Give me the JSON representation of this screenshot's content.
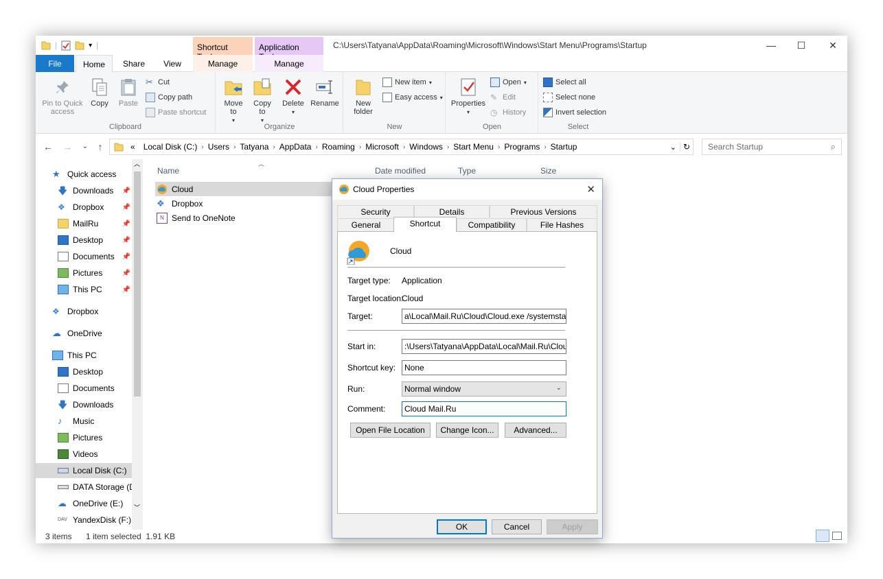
{
  "window": {
    "title_path": "C:\\Users\\Tatyana\\AppData\\Roaming\\Microsoft\\Windows\\Start Menu\\Programs\\Startup",
    "context_tabs": {
      "shortcut_tools": "Shortcut Tools",
      "application_tools": "Application Tools"
    }
  },
  "ribbon_tabs": {
    "file": "File",
    "home": "Home",
    "share": "Share",
    "view": "View",
    "manage1": "Manage",
    "manage2": "Manage"
  },
  "ribbon": {
    "clipboard": {
      "label": "Clipboard",
      "pin": "Pin to Quick access",
      "copy": "Copy",
      "paste": "Paste",
      "cut": "Cut",
      "copy_path": "Copy path",
      "paste_shortcut": "Paste shortcut"
    },
    "organize": {
      "label": "Organize",
      "move_to": "Move to",
      "copy_to": "Copy to",
      "delete": "Delete",
      "rename": "Rename"
    },
    "new": {
      "label": "New",
      "new_folder": "New folder",
      "new_item": "New item",
      "easy_access": "Easy access"
    },
    "open": {
      "label": "Open",
      "properties": "Properties",
      "open": "Open",
      "edit": "Edit",
      "history": "History"
    },
    "select": {
      "label": "Select",
      "select_all": "Select all",
      "select_none": "Select none",
      "invert": "Invert selection"
    }
  },
  "address": {
    "segments": [
      "«",
      "Local Disk (C:)",
      "Users",
      "Tatyana",
      "AppData",
      "Roaming",
      "Microsoft",
      "Windows",
      "Start Menu",
      "Programs",
      "Startup"
    ],
    "search_placeholder": "Search Startup"
  },
  "nav": {
    "items": [
      {
        "label": "Quick access"
      },
      {
        "label": "Downloads"
      },
      {
        "label": "Dropbox"
      },
      {
        "label": "MailRu"
      },
      {
        "label": "Desktop"
      },
      {
        "label": "Documents"
      },
      {
        "label": "Pictures"
      },
      {
        "label": "This PC"
      },
      {
        "label": "Dropbox"
      },
      {
        "label": "OneDrive"
      },
      {
        "label": "This PC"
      },
      {
        "label": "Desktop"
      },
      {
        "label": "Documents"
      },
      {
        "label": "Downloads"
      },
      {
        "label": "Music"
      },
      {
        "label": "Pictures"
      },
      {
        "label": "Videos"
      },
      {
        "label": "Local Disk (C:)"
      },
      {
        "label": "DATA Storage (D"
      },
      {
        "label": "OneDrive (E:)"
      },
      {
        "label": "YandexDisk (F:)"
      }
    ]
  },
  "files": {
    "columns": {
      "name": "Name",
      "date": "Date modified",
      "type": "Type",
      "size": "Size"
    },
    "rows": [
      {
        "name": "Cloud"
      },
      {
        "name": "Dropbox"
      },
      {
        "name": "Send to OneNote"
      }
    ]
  },
  "status": {
    "items": "3 items",
    "selected": "1 item selected  1.91 KB"
  },
  "dialog": {
    "title": "Cloud Properties",
    "tabs": {
      "security": "Security",
      "details": "Details",
      "previous_versions": "Previous Versions",
      "general": "General",
      "shortcut": "Shortcut",
      "compatibility": "Compatibility",
      "file_hashes": "File Hashes"
    },
    "app_name": "Cloud",
    "target_type_label": "Target type:",
    "target_type": "Application",
    "target_location_label": "Target location:",
    "target_location": "Cloud",
    "target_label": "Target:",
    "target": "a\\Local\\Mail.Ru\\Cloud\\Cloud.exe /systemstartup",
    "start_in_label": "Start in:",
    "start_in": ":\\Users\\Tatyana\\AppData\\Local\\Mail.Ru\\Cloud",
    "shortcut_key_label": "Shortcut key:",
    "shortcut_key": "None",
    "run_label": "Run:",
    "run": "Normal window",
    "comment_label": "Comment:",
    "comment": "Cloud Mail.Ru",
    "open_file_location": "Open File Location",
    "change_icon": "Change Icon...",
    "advanced": "Advanced...",
    "ok": "OK",
    "cancel": "Cancel",
    "apply": "Apply"
  }
}
